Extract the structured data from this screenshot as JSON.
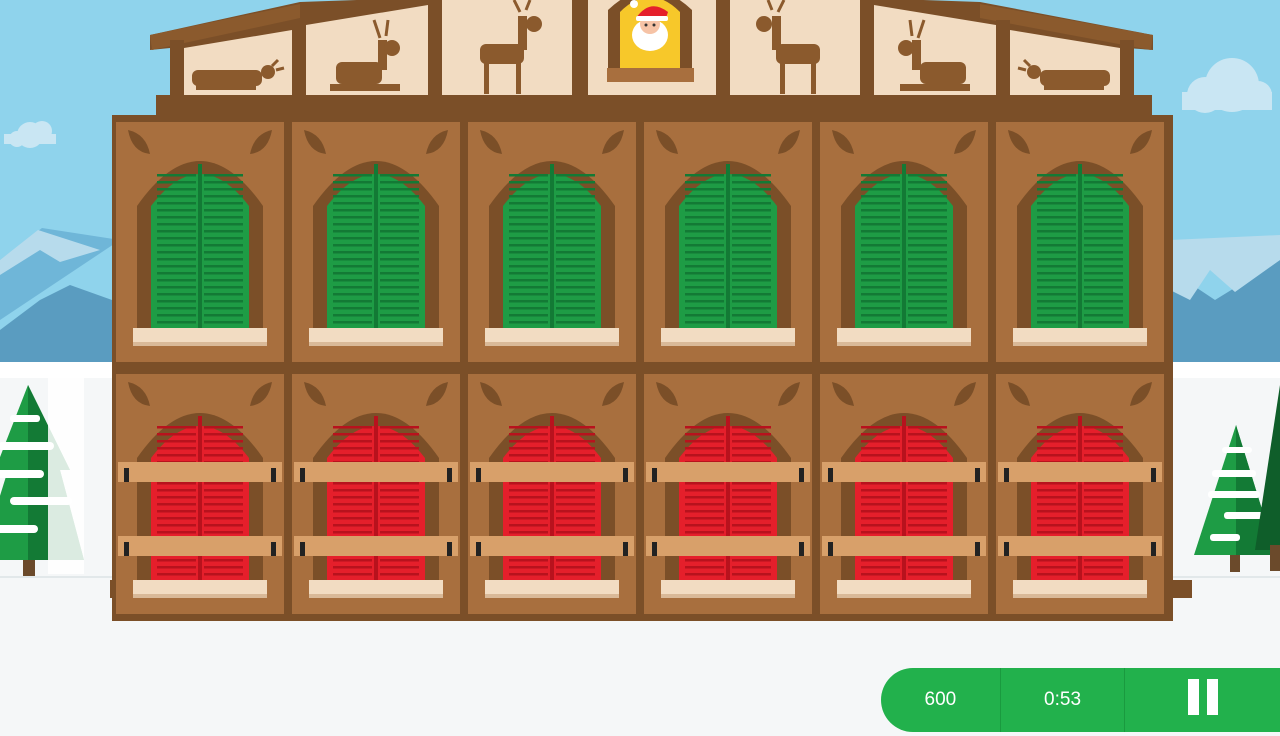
{
  "colors": {
    "sky": "#8fd3ec",
    "snow": "#f5f7f8",
    "wood": "#a86f3e",
    "wood_dark": "#7b4f28",
    "wall_cream": "#f2dcc2",
    "shutter_green": "#1e9c45",
    "shutter_red": "#e51f2b",
    "window_yellow": "#f7c82a",
    "hud_green": "#22b14c"
  },
  "hud": {
    "score": "600",
    "timer": "0:53",
    "pause_icon": "pause-icon"
  },
  "scene": {
    "attic_figures": [
      "reindeer-lying",
      "reindeer-sitting",
      "reindeer-standing",
      "santa",
      "reindeer-standing",
      "reindeer-sitting",
      "reindeer-lying"
    ],
    "upper_row": {
      "state": "green-shutters-closed",
      "count": 6
    },
    "lower_row": {
      "state": "red-shutters-barred",
      "count": 6
    }
  }
}
